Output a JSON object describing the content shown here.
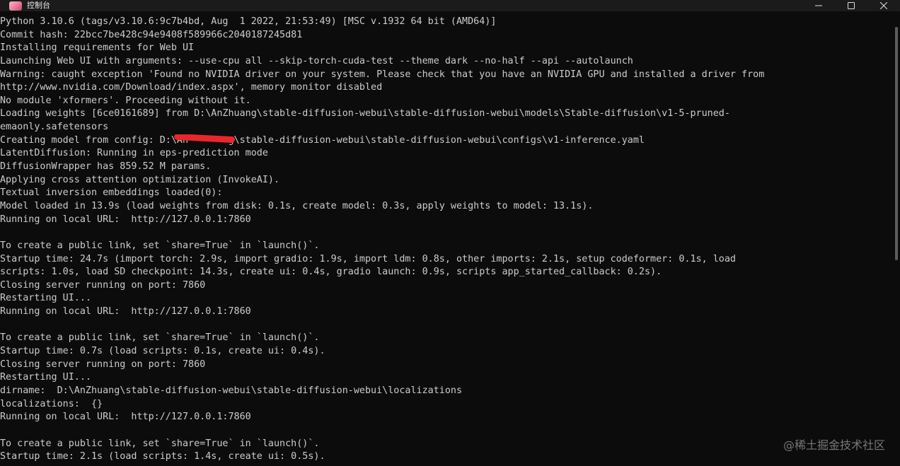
{
  "window": {
    "title": "控制台",
    "app_icon": "anime-avatar-icon",
    "controls": [
      "minimize-icon",
      "maximize-icon",
      "close-icon"
    ]
  },
  "console": {
    "lines": [
      "Python 3.10.6 (tags/v3.10.6:9c7b4bd, Aug  1 2022, 21:53:49) [MSC v.1932 64 bit (AMD64)]",
      "Commit hash: 22bcc7be428c94e9408f589966c2040187245d81",
      "Installing requirements for Web UI",
      "Launching Web UI with arguments: --use-cpu all --skip-torch-cuda-test --theme dark --no-half --api --autolaunch",
      "Warning: caught exception 'Found no NVIDIA driver on your system. Please check that you have an NVIDIA GPU and installed a driver from",
      "http://www.nvidia.com/Download/index.aspx', memory monitor disabled",
      "No module 'xformers'. Proceeding without it.",
      "Loading weights [6ce0161689] from D:\\AnZhuang\\stable-diffusion-webui\\stable-diffusion-webui\\models\\Stable-diffusion\\v1-5-pruned-",
      "emaonly.safetensors",
      "REDACTED_LINE",
      "LatentDiffusion: Running in eps-prediction mode",
      "DiffusionWrapper has 859.52 M params.",
      "Applying cross attention optimization (InvokeAI).",
      "Textual inversion embeddings loaded(0):",
      "Model loaded in 13.9s (load weights from disk: 0.1s, create model: 0.3s, apply weights to model: 13.1s).",
      "Running on local URL:  http://127.0.0.1:7860",
      "",
      "To create a public link, set `share=True` in `launch()`.",
      "Startup time: 24.7s (import torch: 2.9s, import gradio: 1.9s, import ldm: 0.8s, other imports: 2.1s, setup codeformer: 0.1s, load",
      "scripts: 1.0s, load SD checkpoint: 14.3s, create ui: 0.4s, gradio launch: 0.9s, scripts app_started_callback: 0.2s).",
      "Closing server running on port: 7860",
      "Restarting UI...",
      "Running on local URL:  http://127.0.0.1:7860",
      "",
      "To create a public link, set `share=True` in `launch()`.",
      "Startup time: 0.7s (load scripts: 0.1s, create ui: 0.4s).",
      "Closing server running on port: 7860",
      "Restarting UI...",
      "dirname:  D:\\AnZhuang\\stable-diffusion-webui\\stable-diffusion-webui\\localizations",
      "localizations:  {}",
      "Running on local URL:  http://127.0.0.1:7860",
      "",
      "To create a public link, set `share=True` in `launch()`.",
      "Startup time: 2.1s (load scripts: 1.4s, create ui: 0.5s)."
    ],
    "redacted_line": {
      "before": "Creating model from config: D:\\An",
      "after": "g\\stable-diffusion-webui\\stable-diffusion-webui\\configs\\v1-inference.yaml"
    }
  },
  "watermark": "@稀土掘金技术社区",
  "colors": {
    "background": "#0c0c0c",
    "text": "#cccccc",
    "redaction": "#e8262c"
  }
}
